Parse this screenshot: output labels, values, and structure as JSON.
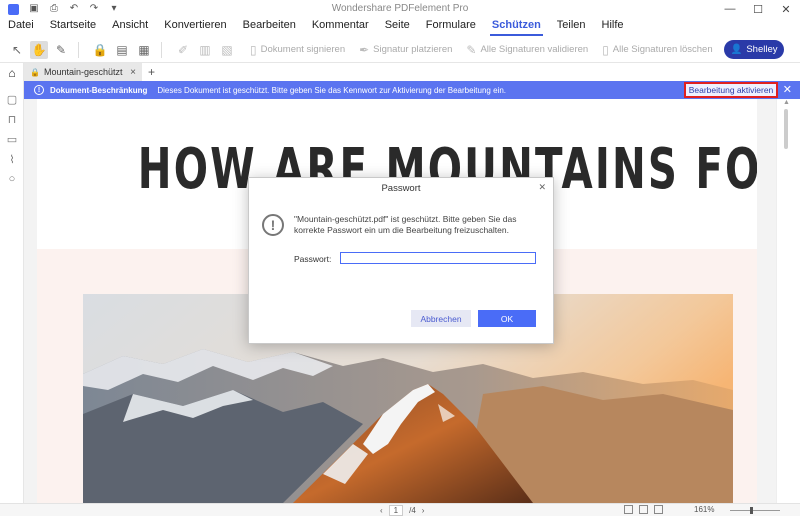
{
  "app": {
    "title": "Wondershare PDFelement Pro"
  },
  "window_controls": {
    "minimize": "—",
    "maximize": "☐",
    "close": "✕"
  },
  "menu": {
    "items": [
      "Datei",
      "Startseite",
      "Ansicht",
      "Konvertieren",
      "Bearbeiten",
      "Kommentar",
      "Seite",
      "Formulare",
      "Schützen",
      "Teilen",
      "Hilfe"
    ],
    "active": "Schützen"
  },
  "toolbar": {
    "sign_document": "Dokument signieren",
    "place_signature": "Signatur platzieren",
    "validate_all": "Alle Signaturen validieren",
    "delete_all": "Alle Signaturen löschen",
    "user": "Shelley"
  },
  "tabs": {
    "document": "Mountain-geschützt",
    "add": "+"
  },
  "notice": {
    "label": "Dokument-Beschränkung",
    "message": "Dieses Dokument ist geschützt. Bitte geben Sie das Kennwort zur Aktivierung der Bearbeitung ein.",
    "button": "Bearbeitung aktivieren"
  },
  "document": {
    "headline": "HOW ARE MOUNTAINS FORMED?"
  },
  "dialog": {
    "title": "Passwort",
    "message": "\"Mountain-geschützt.pdf\" ist geschützt. Bitte geben Sie das korrekte Passwort ein um die Bearbeitung freizuschalten.",
    "password_label": "Passwort:",
    "password_value": "",
    "cancel": "Abbrechen",
    "ok": "OK"
  },
  "status": {
    "page_current": "1",
    "page_total": "/4",
    "zoom": "161%"
  },
  "colors": {
    "accent": "#4a6cf7",
    "notice_bg": "#5b74f0",
    "user_btn": "#2a3aa8",
    "highlight_border": "#e02020"
  }
}
